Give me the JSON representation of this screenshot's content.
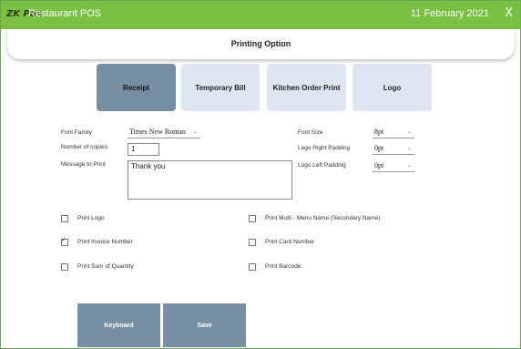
{
  "titlebar": {
    "brand": "ZK Pos",
    "title": "Restaurant POS",
    "date": "11 February 2021",
    "close_glyph": "X"
  },
  "page": {
    "title": "Printing Option"
  },
  "tabs": [
    {
      "label": "Receipt",
      "active": true
    },
    {
      "label": "Temporary Bill",
      "active": false
    },
    {
      "label": "Kitchen Order Print",
      "active": false
    },
    {
      "label": "Logo",
      "active": false
    }
  ],
  "form": {
    "font_family": {
      "label": "Font Family",
      "value": "Times New Roman"
    },
    "copies": {
      "label": "Number of copies",
      "value": "1"
    },
    "message": {
      "label": "Message to Print",
      "value": "Thank you"
    },
    "font_size": {
      "label": "Font Size",
      "value": "8pt"
    },
    "logo_right_padding": {
      "label": "Logo Right Padding",
      "value": "0pt"
    },
    "logo_left_padding": {
      "label": "Logo Left Padding",
      "value": "0pt"
    }
  },
  "checkboxes": {
    "print_logo": {
      "label": "Print Logo",
      "checked": false
    },
    "print_invoice_number": {
      "label": "Print Invoice Number",
      "checked": true
    },
    "print_sum_quantity": {
      "label": "Print Sum of Quantity",
      "checked": false
    },
    "print_multi_menu": {
      "label": "Print Multi - Menu Name (Secondary Name)",
      "checked": false
    },
    "print_card_number": {
      "label": "Print Card Number",
      "checked": false
    },
    "print_barcode": {
      "label": "Print Barcode",
      "checked": false
    }
  },
  "buttons": {
    "keyboard": "Keyboard",
    "save": "Save"
  },
  "colors": {
    "titlebar": "#7ac143",
    "active_tab": "#778ea3",
    "inactive_tab": "#dfe5f1",
    "button": "#778ea3"
  },
  "icons": {
    "dropdown": "chevron-down-icon",
    "close": "close-icon",
    "check": "check-icon"
  }
}
